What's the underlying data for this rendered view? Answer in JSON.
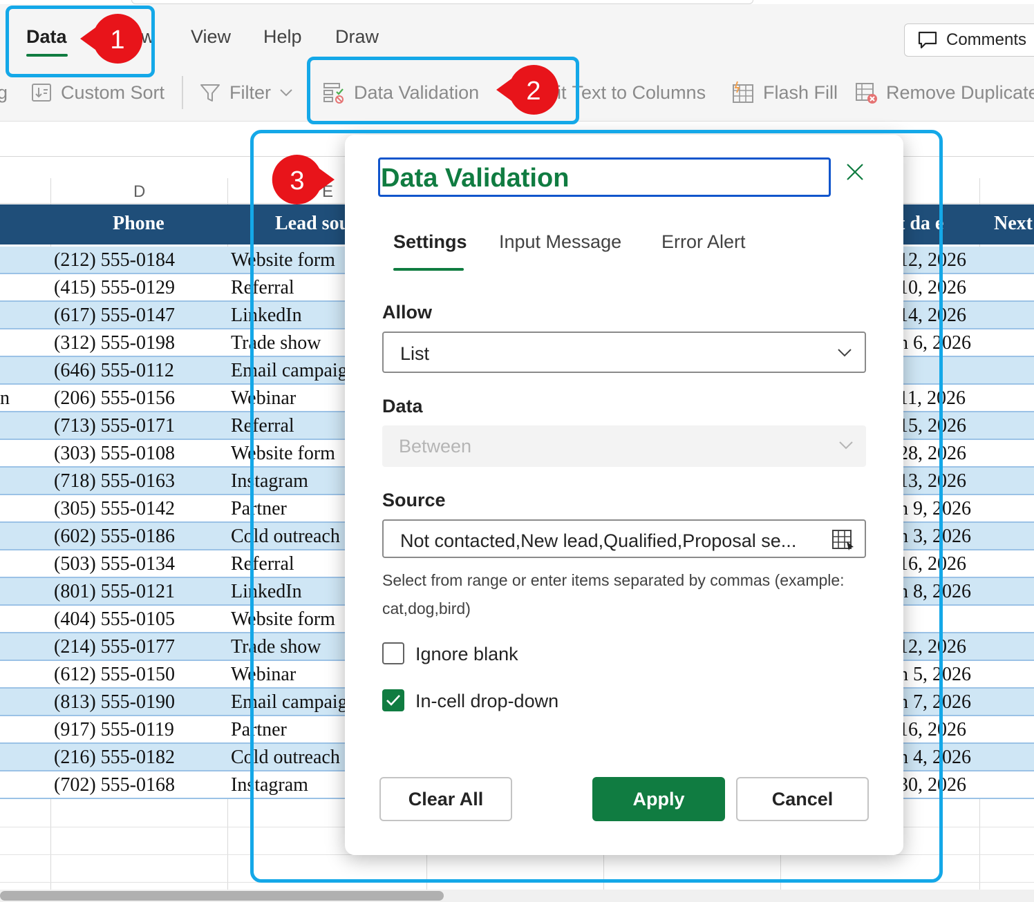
{
  "menu": {
    "tabs": [
      {
        "label": "Data",
        "active": true
      },
      {
        "label": "w",
        "active": false
      },
      {
        "label": "View",
        "active": false
      },
      {
        "label": "Help",
        "active": false
      },
      {
        "label": "Draw",
        "active": false
      }
    ],
    "comments_label": "Comments"
  },
  "toolbar": {
    "sort_partial": "g",
    "custom_sort": "Custom Sort",
    "filter": "Filter",
    "data_validation": "Data Validation",
    "split_partial": "it",
    "text_to_columns": "Text to Columns",
    "flash_fill": "Flash Fill",
    "remove_duplicates": "Remove Duplicate"
  },
  "sheet": {
    "columns": [
      "D",
      "E"
    ],
    "headers": {
      "phone": "Phone",
      "lead_source": "Lead sou",
      "date_partial": "t da  e",
      "next_partial": "Next"
    },
    "rows": [
      {
        "left": "",
        "phone": "(212) 555-0184",
        "source": "Website form",
        "date": "12, 2026"
      },
      {
        "left": "",
        "phone": "(415) 555-0129",
        "source": "Referral",
        "date": "10, 2026"
      },
      {
        "left": "",
        "phone": "(617) 555-0147",
        "source": "LinkedIn",
        "date": "14, 2026"
      },
      {
        "left": "",
        "phone": "(312) 555-0198",
        "source": "Trade show",
        "date": "n 6, 2026"
      },
      {
        "left": "",
        "phone": "(646) 555-0112",
        "source": "Email campaign",
        "date": ""
      },
      {
        "left": "n",
        "phone": "(206) 555-0156",
        "source": "Webinar",
        "date": "11, 2026"
      },
      {
        "left": "",
        "phone": "(713) 555-0171",
        "source": "Referral",
        "date": "15, 2026"
      },
      {
        "left": "",
        "phone": "(303) 555-0108",
        "source": "Website form",
        "date": "28, 2026"
      },
      {
        "left": "",
        "phone": "(718) 555-0163",
        "source": "Instagram",
        "date": "13, 2026"
      },
      {
        "left": "",
        "phone": "(305) 555-0142",
        "source": "Partner",
        "date": "n 9, 2026"
      },
      {
        "left": "",
        "phone": "(602) 555-0186",
        "source": "Cold outreach",
        "date": "n 3, 2026"
      },
      {
        "left": "",
        "phone": "(503) 555-0134",
        "source": "Referral",
        "date": "16, 2026"
      },
      {
        "left": "",
        "phone": "(801) 555-0121",
        "source": "LinkedIn",
        "date": "n 8, 2026"
      },
      {
        "left": "",
        "phone": "(404) 555-0105",
        "source": "Website form",
        "date": ""
      },
      {
        "left": "",
        "phone": "(214) 555-0177",
        "source": "Trade show",
        "date": "12, 2026"
      },
      {
        "left": "",
        "phone": "(612) 555-0150",
        "source": "Webinar",
        "date": "n 5, 2026"
      },
      {
        "left": "",
        "phone": "(813) 555-0190",
        "source": "Email campaign",
        "date": "n 7, 2026"
      },
      {
        "left": "",
        "phone": "(917) 555-0119",
        "source": "Partner",
        "date": "16, 2026"
      },
      {
        "left": "",
        "phone": "(216) 555-0182",
        "source": "Cold outreach",
        "date": "n 4, 2026"
      },
      {
        "left": "",
        "phone": "(702) 555-0168",
        "source": "Instagram",
        "date": "30, 2026"
      }
    ]
  },
  "dialog": {
    "title": "Data Validation",
    "tabs": [
      "Settings",
      "Input Message",
      "Error Alert"
    ],
    "allow_label": "Allow",
    "allow_value": "List",
    "data_label": "Data",
    "data_value": "Between",
    "source_label": "Source",
    "source_value": "Not contacted,New lead,Qualified,Proposal se...",
    "helper_text": "Select from range or enter items separated by commas (example: cat,dog,bird)",
    "ignore_blank_label": "Ignore blank",
    "ignore_blank_checked": false,
    "in_cell_dropdown_label": "In-cell drop-down",
    "in_cell_dropdown_checked": true,
    "clear_all": "Clear All",
    "apply": "Apply",
    "cancel": "Cancel"
  },
  "annotations": [
    {
      "number": "1"
    },
    {
      "number": "2"
    },
    {
      "number": "3"
    }
  ],
  "colors": {
    "accent_green": "#107c41",
    "header_navy": "#1f4e79",
    "row_band": "#cfe6f5",
    "highlight_blue": "#14a8e8",
    "badge_red": "#e8141a"
  }
}
